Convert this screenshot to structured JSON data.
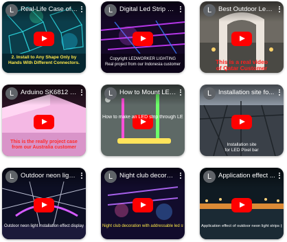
{
  "channel_avatar_letter": "L",
  "videos": [
    {
      "title": "Real-Life Case of P...",
      "caption": "2. Install to Any Shape Only by\nHands With Different Connectors."
    },
    {
      "title": "Digital Led Strip Co...",
      "caption": "Copyright LEDWORKER LIGHTING\nReal project from our Indonesia customer"
    },
    {
      "title": "Best Outdoor Led ...",
      "caption": "This is a real video\nof Qatar Customer"
    },
    {
      "title": "Arduino SK6812 In...",
      "caption": "This is the really project case\nfrom our Australia customer"
    },
    {
      "title": "How to Mount LED...",
      "caption": "How to make an LED strip through LED strip"
    },
    {
      "title": "Installation site fo...",
      "caption": "Installation site\nfor LED Pixel bar"
    },
    {
      "title": "Outdoor neon light ...",
      "caption": "Outdoor neon light installation effect display"
    },
    {
      "title": "Night club decorati...",
      "caption": "Night club decoration with addressable led strip lights"
    },
    {
      "title": "Application effect ...",
      "caption": "Application effect of outdoor neon light strips (customer c..."
    }
  ]
}
